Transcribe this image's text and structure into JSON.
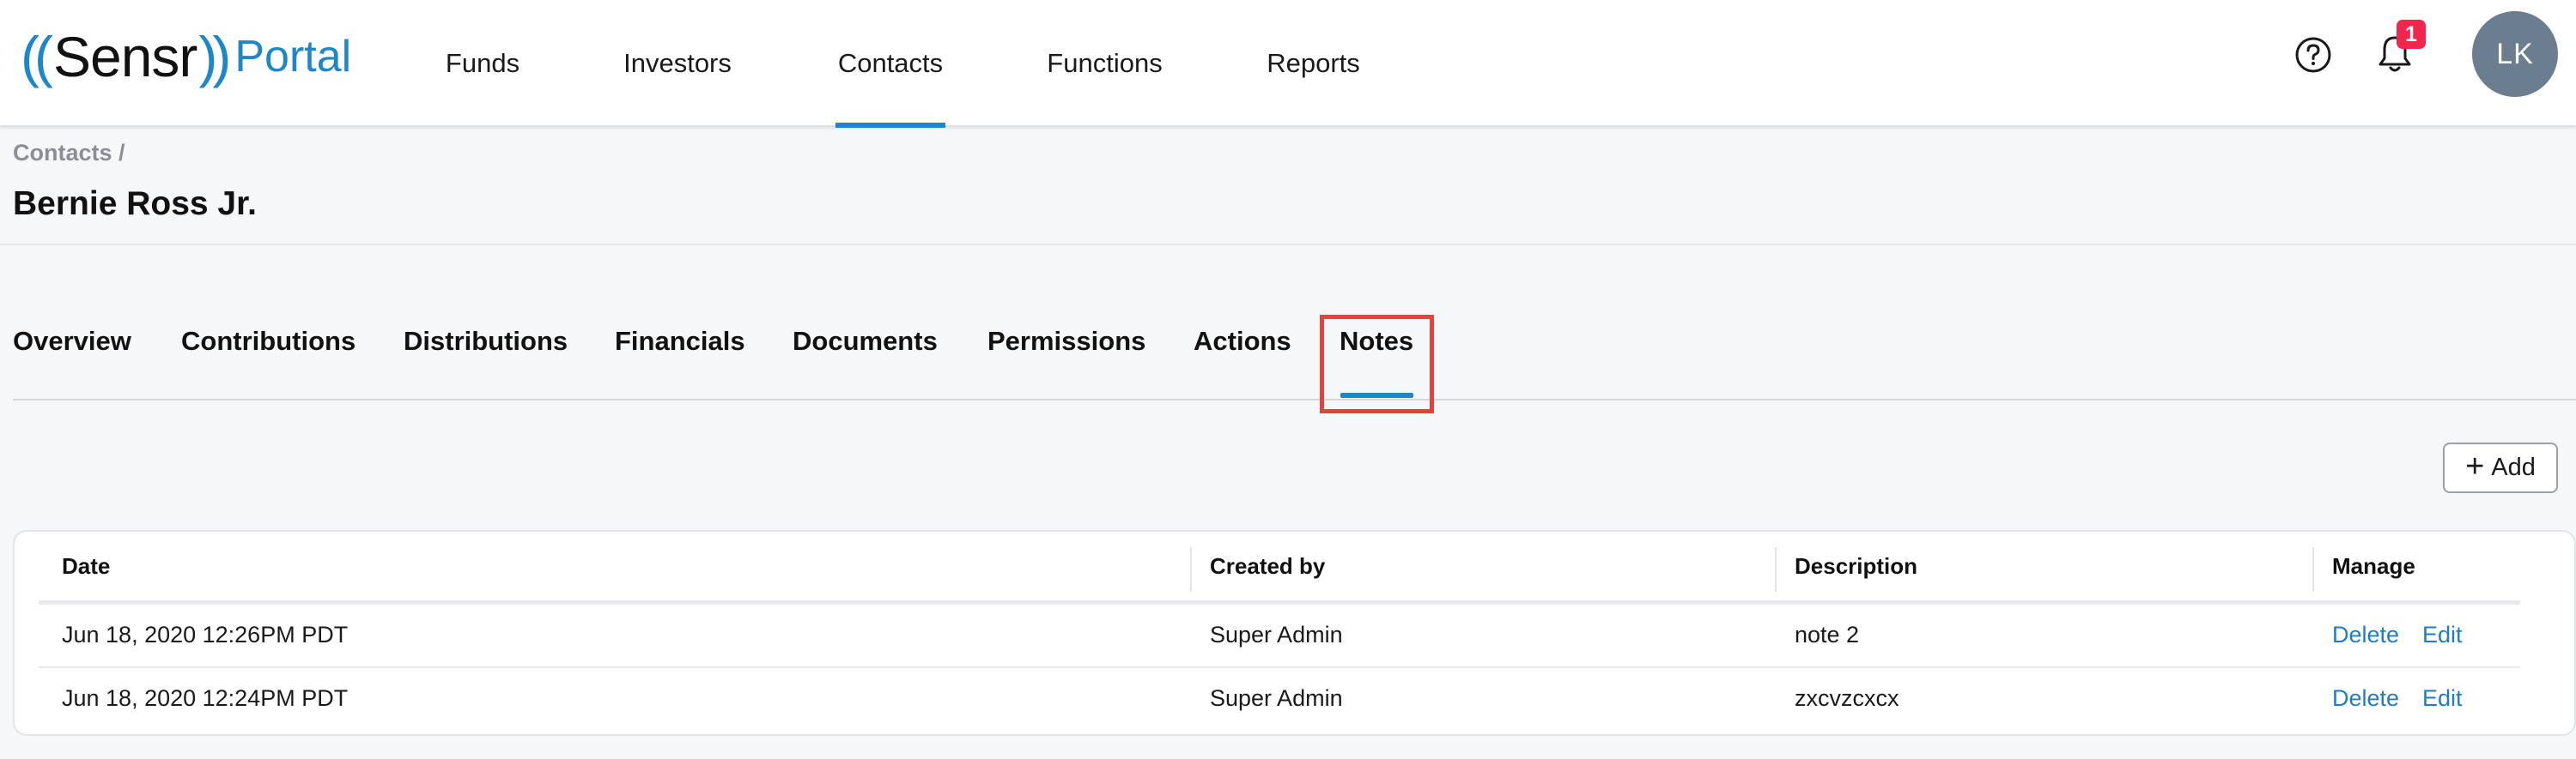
{
  "header": {
    "logo": {
      "open": "((",
      "brand": "Sensr",
      "close": "))",
      "portal": "Portal"
    },
    "nav": [
      "Funds",
      "Investors",
      "Contacts",
      "Functions",
      "Reports"
    ],
    "active_nav": "Contacts",
    "notifications_count": "1",
    "avatar_initials": "LK"
  },
  "breadcrumb": "Contacts /",
  "page_title": "Bernie Ross Jr.",
  "tabs": [
    "Overview",
    "Contributions",
    "Distributions",
    "Financials",
    "Documents",
    "Permissions",
    "Actions",
    "Notes"
  ],
  "active_tab": "Notes",
  "add_label": "Add",
  "table": {
    "columns": [
      "Date",
      "Created by",
      "Description",
      "Manage"
    ],
    "rows": [
      {
        "date": "Jun 18, 2020 12:26PM PDT",
        "created_by": "Super Admin",
        "description": "note 2",
        "delete": "Delete",
        "edit": "Edit"
      },
      {
        "date": "Jun 18, 2020 12:24PM PDT",
        "created_by": "Super Admin",
        "description": "zxcvzcxcx",
        "delete": "Delete",
        "edit": "Edit"
      }
    ]
  },
  "colors": {
    "accent": "#1f86c8",
    "highlight_box": "#e8403a",
    "badge": "#f0264f",
    "avatar": "#6b7e8f"
  }
}
